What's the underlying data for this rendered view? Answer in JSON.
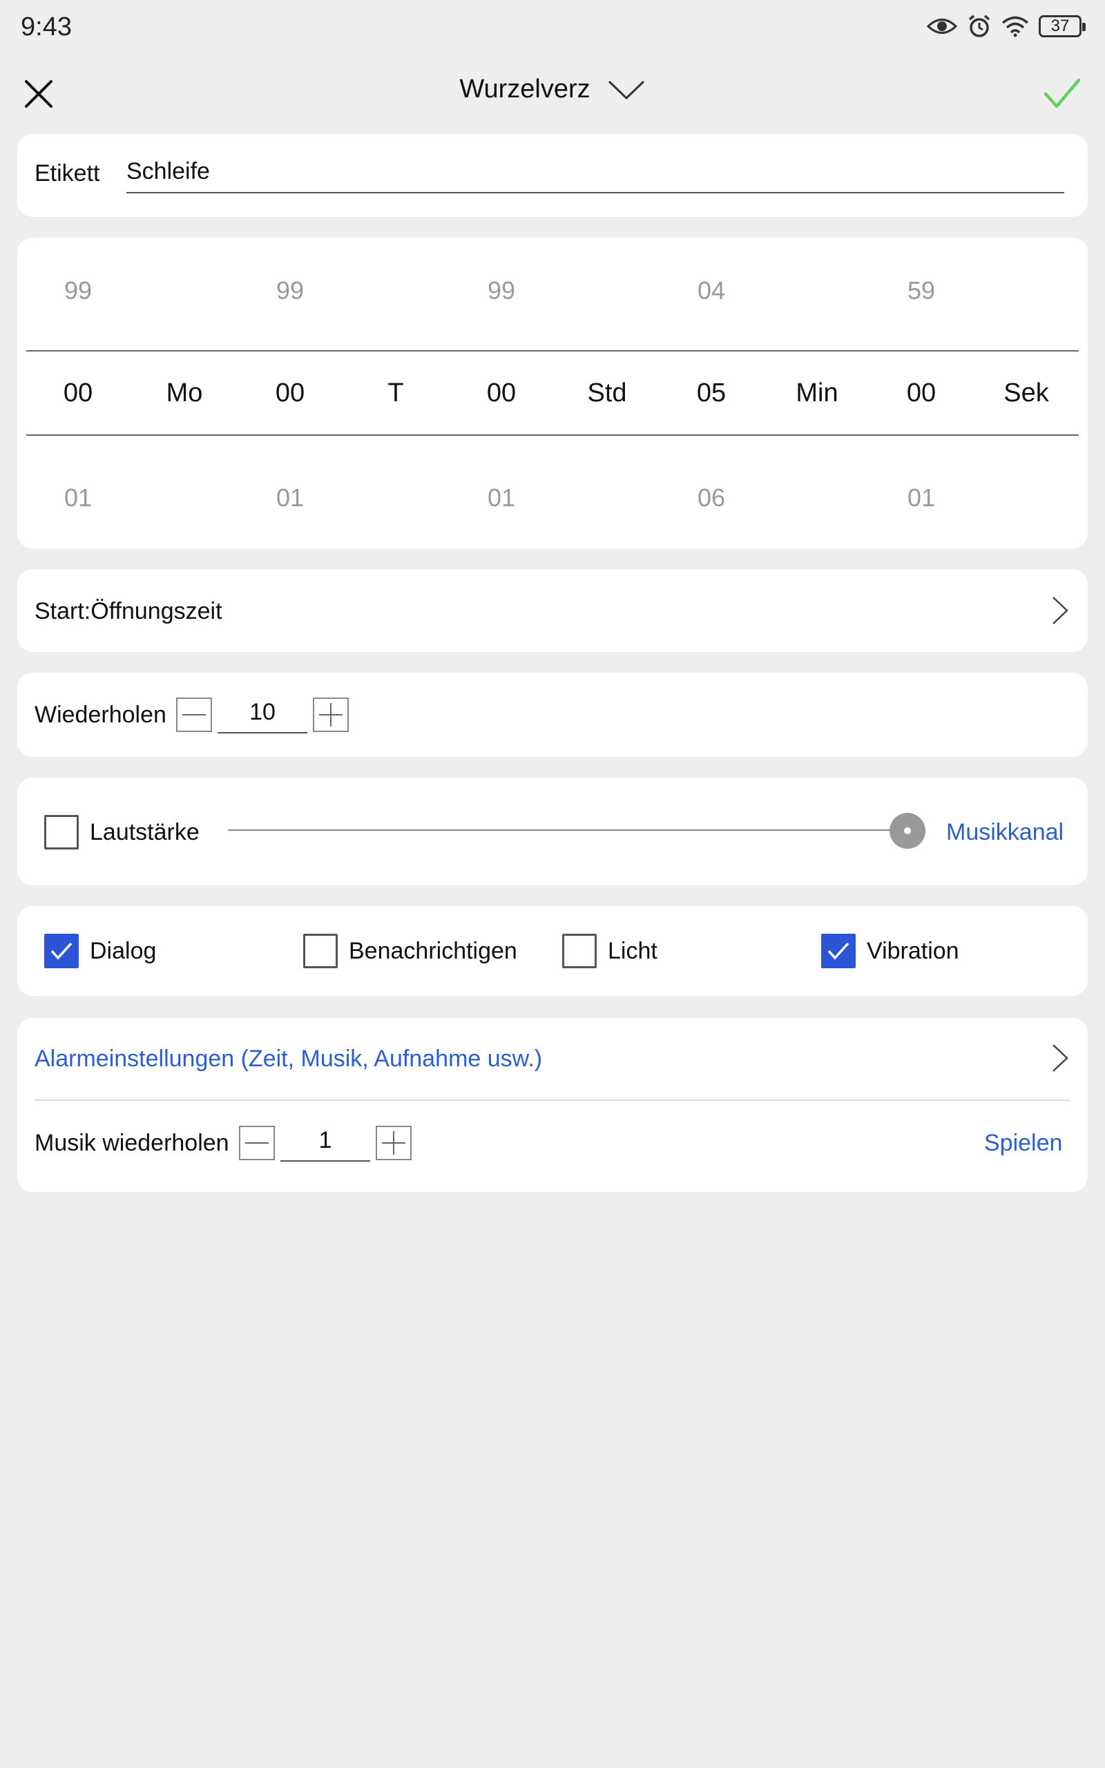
{
  "status": {
    "time": "9:43",
    "battery": "37"
  },
  "header": {
    "title": "Wurzelverz"
  },
  "label_field": {
    "label": "Etikett",
    "value": "Schleife"
  },
  "picker": {
    "columns": [
      {
        "above": "99",
        "value": "00",
        "below": "01",
        "unit": "Mo"
      },
      {
        "above": "99",
        "value": "00",
        "below": "01",
        "unit": "T"
      },
      {
        "above": "99",
        "value": "00",
        "below": "01",
        "unit": "Std"
      },
      {
        "above": "04",
        "value": "05",
        "below": "06",
        "unit": "Min"
      },
      {
        "above": "59",
        "value": "00",
        "below": "01",
        "unit": "Sek"
      }
    ]
  },
  "start": {
    "label": "Start:Öffnungszeit"
  },
  "repeat": {
    "label": "Wiederholen",
    "value": "10"
  },
  "volume": {
    "label": "Lautstärke",
    "checked": false,
    "channel": "Musikkanal",
    "level": 1.0
  },
  "options": [
    {
      "label": "Dialog",
      "checked": true
    },
    {
      "label": "Benachrichtigen",
      "checked": false
    },
    {
      "label": "Licht",
      "checked": false
    },
    {
      "label": "Vibration",
      "checked": true
    }
  ],
  "alarm": {
    "settings_link": "Alarmeinstellungen (Zeit, Musik, Aufnahme usw.)",
    "music_repeat_label": "Musik wiederholen",
    "music_repeat_value": "1",
    "play_label": "Spielen"
  },
  "colors": {
    "accent_blue": "#2c5fc9",
    "check_green": "#5fd35a",
    "checkbox_blue": "#2b55d6"
  }
}
